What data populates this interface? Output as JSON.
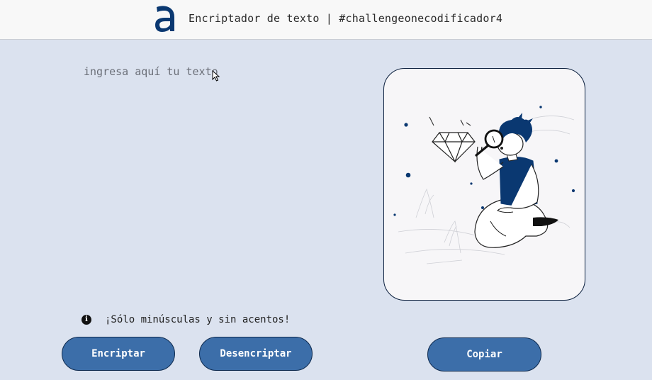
{
  "header": {
    "logo_icon": "alura-a-logo-icon",
    "title": "Encriptador de texto | #challengeonecodificador4"
  },
  "input": {
    "placeholder": "ingresa aquí tu texto",
    "value": ""
  },
  "illustration": {
    "icon": "person-with-magnifier-and-diamond-illustration"
  },
  "hint": {
    "icon": "info-icon",
    "icon_glyph": "i",
    "text": "¡Sólo minúsculas y sin acentos!"
  },
  "buttons": {
    "encrypt_label": "Encriptar",
    "decrypt_label": "Desencriptar",
    "copy_label": "Copiar"
  },
  "colors": {
    "background": "#dbe2ef",
    "header_bg": "#f8f8f8",
    "button_bg": "#3c6ea9",
    "button_border": "#0e2a4e",
    "brand": "#0a3871",
    "card_border": "#0b1f3d"
  }
}
